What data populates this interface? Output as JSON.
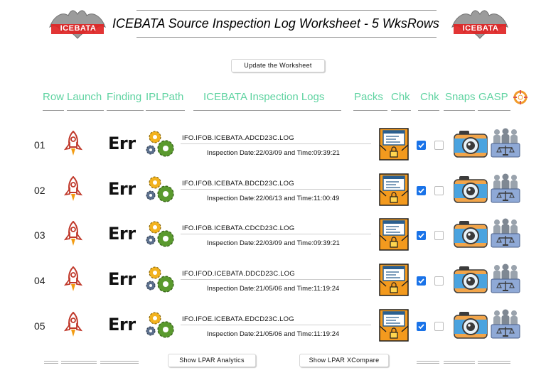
{
  "header": {
    "logo_text": "ICEBATA",
    "title": "ICEBATA Source Inspection Log Worksheet - 5 WksRows",
    "update_button": "Update  the  Worksheet"
  },
  "columns": [
    "Row",
    "Launch",
    "Finding",
    "IPLPath",
    "ICEBATA Inspection  Logs",
    "Packs",
    "Chk",
    "Chk",
    "Snaps",
    "GASP"
  ],
  "rows": [
    {
      "num": "01",
      "finding": "Err",
      "log": "IFO.IFOB.ICEBATA.ADCD23C.LOG",
      "inspection": "Inspection Date:22/03/09 and Time:09:39:21",
      "chk1": true,
      "chk2": false
    },
    {
      "num": "02",
      "finding": "Err",
      "log": "IFO.IFOB.ICEBATA.BDCD23C.LOG",
      "inspection": "Inspection Date:22/06/13 and Time:11:00:49",
      "chk1": true,
      "chk2": false
    },
    {
      "num": "03",
      "finding": "Err",
      "log": "IFO.IFOB.ICEBATA.CDCD23C.LOG",
      "inspection": "Inspection Date:22/03/09 and Time:09:39:21",
      "chk1": true,
      "chk2": false
    },
    {
      "num": "04",
      "finding": "Err",
      "log": "IFO.IFOD.ICEBATA.DDCD23C.LOG",
      "inspection": "Inspection Date:21/05/06 and Time:11:19:24",
      "chk1": true,
      "chk2": false
    },
    {
      "num": "05",
      "finding": "Err",
      "log": "IFO.IFOE.ICEBATA.EDCD23C.LOG",
      "inspection": "Inspection Date:21/05/06 and Time:11:19:24",
      "chk1": true,
      "chk2": false
    }
  ],
  "footer": {
    "analytics_button": "Show LPAR  Analytics",
    "xcompare_button": "Show LPAR  XCompare"
  },
  "colors": {
    "header_text": "#5fd3a1",
    "logo_red": "#d32b2b",
    "checkbox_on": "#1a73e8",
    "package_orange": "#f39a1e",
    "camera_blue": "#4aa3df",
    "camera_orange": "#f2a54a",
    "gear_green": "#5a9a2e",
    "gear_yellow": "#f2b21e"
  },
  "icons": {
    "logo": "bat-logo-icon",
    "launch": "rocket-icon",
    "iplpath": "gears-icon",
    "packs": "locked-package-icon",
    "snaps": "camera-icon",
    "gasp": "people-scale-icon",
    "target": "lifebuoy-icon"
  }
}
